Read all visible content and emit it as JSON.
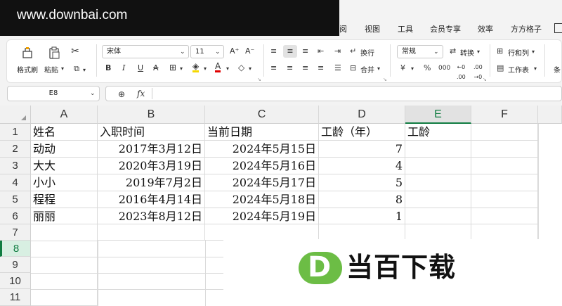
{
  "watermark_top": "www.downbai.com",
  "menu": [
    "阅",
    "视图",
    "工具",
    "会员专享",
    "效率",
    "方方格子"
  ],
  "ribbon": {
    "format_painter": "格式刷",
    "paste": "粘贴",
    "font_name": "宋体",
    "font_size": "11",
    "wrap": "换行",
    "merge": "合并",
    "number_format": "常规",
    "convert": "转换",
    "rows_cols": "行和列",
    "worksheet": "工作表",
    "cond": "条",
    "percent": "%",
    "thousands": "000"
  },
  "formula_bar": {
    "cell_ref": "E8",
    "fx": "fx",
    "value": ""
  },
  "columns": [
    "A",
    "B",
    "C",
    "D",
    "E",
    "F"
  ],
  "rows": [
    "1",
    "2",
    "3",
    "4",
    "5",
    "6",
    "7",
    "8",
    "9",
    "10",
    "11"
  ],
  "table": {
    "header": [
      "姓名",
      "入职时间",
      "当前日期",
      "工龄（年）",
      "工龄"
    ],
    "data": [
      [
        "动动",
        "2017年3月12日",
        "2024年5月15日",
        "7",
        ""
      ],
      [
        "大大",
        "2020年3月19日",
        "2024年5月16日",
        "4",
        ""
      ],
      [
        "小小",
        "2019年7月2日",
        "2024年5月17日",
        "5",
        ""
      ],
      [
        "程程",
        "2016年4月14日",
        "2024年5月18日",
        "8",
        ""
      ],
      [
        "丽丽",
        "2023年8月12日",
        "2024年5月19日",
        "1",
        ""
      ]
    ]
  },
  "logo": {
    "letter": "D",
    "text": "当百下载"
  },
  "colors": {
    "selection_green": "#107c41",
    "logo_green": "#6cbd45"
  }
}
